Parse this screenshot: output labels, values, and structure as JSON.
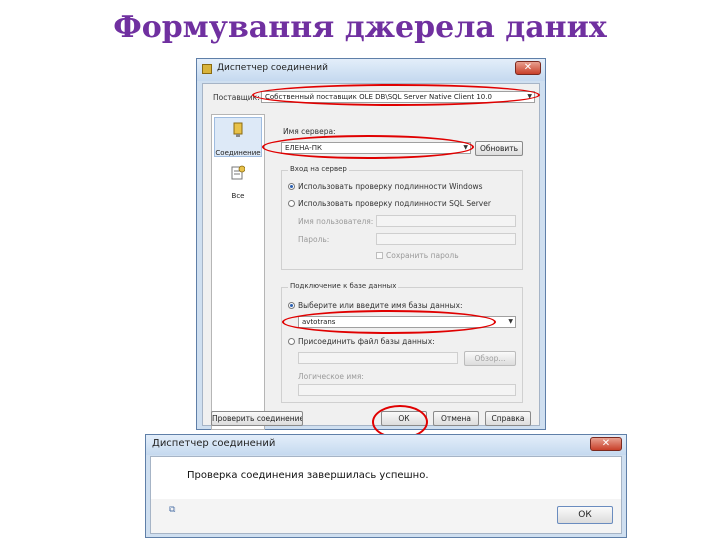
{
  "slide": {
    "title": "Формування джерела даних"
  },
  "connection_dialog": {
    "title": "Диспетчер соединений",
    "provider_label": "Поставщик:",
    "provider_value": "Собственный поставщик OLE DB\\SQL Server Native Client 10.0",
    "sidebar": {
      "items": [
        {
          "label": "Соединение"
        },
        {
          "label": "Все"
        }
      ]
    },
    "server_name_label": "Имя сервера:",
    "server_name_value": "ЕЛЕНА-ПК",
    "refresh_button": "Обновить",
    "login_group": {
      "title": "Вход на сервер",
      "windows_auth": "Использовать проверку подлинности Windows",
      "sql_auth": "Использовать проверку подлинности SQL Server",
      "user_label": "Имя пользователя:",
      "password_label": "Пароль:",
      "save_password": "Сохранить пароль"
    },
    "db_group": {
      "title": "Подключение к базе данных",
      "select_db": "Выберите или введите имя базы данных:",
      "db_value": "avtotrans",
      "attach_file": "Присоединить файл базы данных:",
      "browse_button": "Обзор...",
      "logical_name_label": "Логическое имя:"
    },
    "test_button": "Проверить соединение",
    "ok_button": "ОК",
    "cancel_button": "Отмена",
    "help_button": "Справка"
  },
  "message_dialog": {
    "title": "Диспетчер соединений",
    "message": "Проверка соединения завершилась успешно.",
    "ok_button": "ОК"
  }
}
